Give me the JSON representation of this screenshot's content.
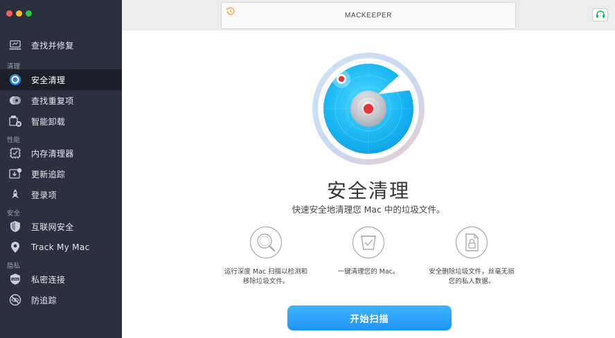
{
  "window": {
    "title": "MACKEEPER"
  },
  "sidebar": {
    "items": [
      {
        "label": "查找并修复",
        "icon": "laptop-icon"
      },
      {
        "section": "清理"
      },
      {
        "label": "安全清理",
        "icon": "safe-cleanup-icon",
        "active": true
      },
      {
        "label": "查找重复项",
        "icon": "duplicates-icon"
      },
      {
        "label": "智能卸载",
        "icon": "uninstaller-icon"
      },
      {
        "section": "性能"
      },
      {
        "label": "内存清理器",
        "icon": "memory-icon"
      },
      {
        "label": "更新追踪",
        "icon": "update-icon"
      },
      {
        "label": "登录项",
        "icon": "rocket-icon"
      },
      {
        "section": "安全"
      },
      {
        "label": "互联网安全",
        "icon": "shield-icon"
      },
      {
        "label": "Track My Mac",
        "icon": "location-pin-icon"
      },
      {
        "section": "隐私"
      },
      {
        "label": "私密连接",
        "icon": "vpn-icon"
      },
      {
        "label": "防追踪",
        "icon": "anti-tracking-icon"
      }
    ]
  },
  "main": {
    "title": "安全清理",
    "subtitle": "快速安全地清理您 Mac 中的垃圾文件。",
    "features": [
      {
        "icon": "magnifier-icon",
        "text_line1": "运行深度 Mac 扫描以检测和",
        "text_line2": "移除垃圾文件。"
      },
      {
        "icon": "trash-bin-icon",
        "text_line1": "一键清理您的 Mac。",
        "text_line2": ""
      },
      {
        "icon": "locked-file-icon",
        "text_line1": "安全删除垃圾文件，丝毫无损",
        "text_line2": "您的私人数据。"
      }
    ],
    "scan_button": "开始扫描"
  },
  "colors": {
    "sidebar_bg": "#2c2f3d",
    "sidebar_active": "#1c1e28",
    "accent_blue": "#1f93f2",
    "radar_red": "#e8333a"
  }
}
